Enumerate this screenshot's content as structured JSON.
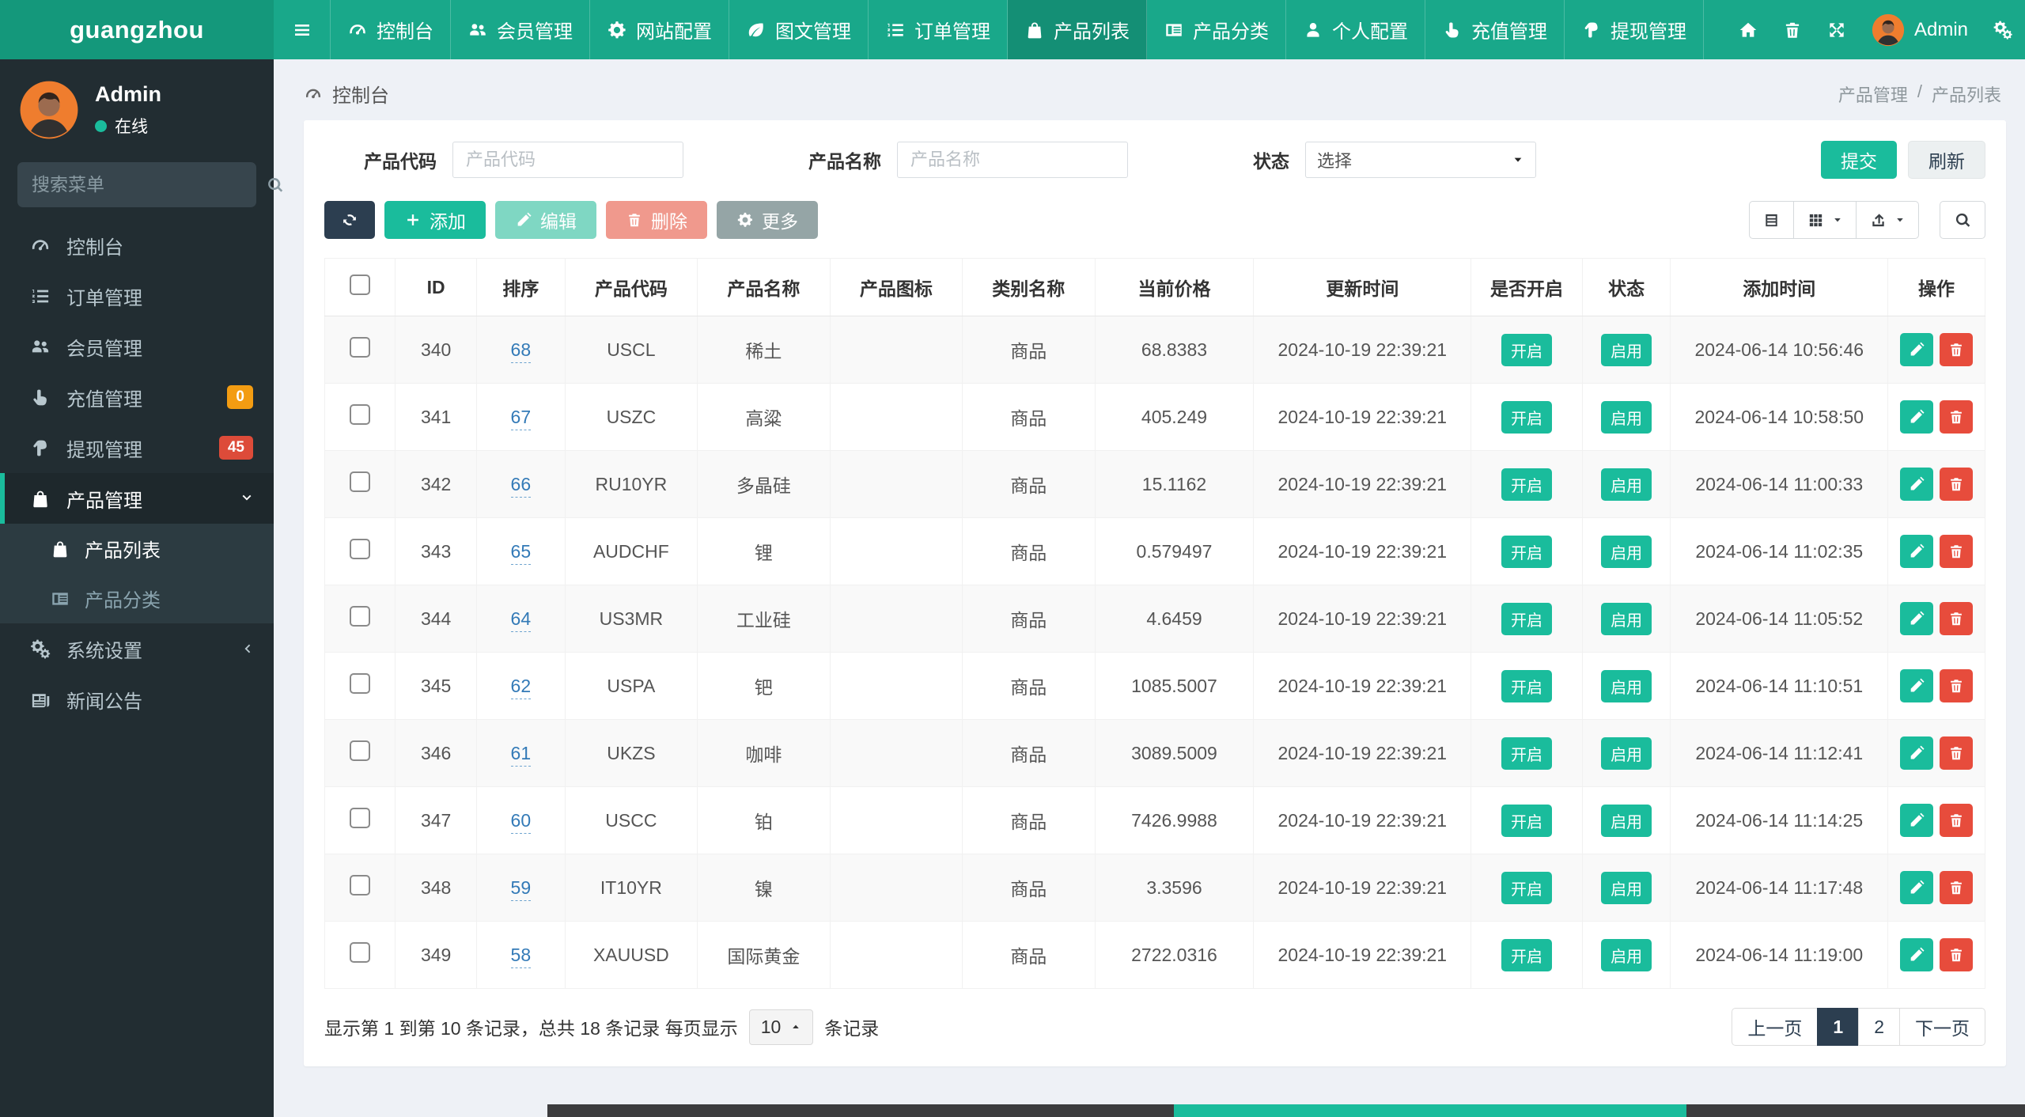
{
  "brand": "guangzhou",
  "colors": {
    "accent": "#1abc9c",
    "navbar": "#19a88a",
    "navbar_active": "#148f75",
    "sidebar": "#222d32",
    "submenu": "#2c3b41",
    "navy": "#2c3e50",
    "danger": "#e74c3c",
    "warning_badge": "#f39c12",
    "danger_badge": "#dd4b39"
  },
  "topnav": {
    "toggle_icon": "hamburger-icon",
    "items": [
      {
        "label": "控制台",
        "icon": "dashboard-icon",
        "active": false
      },
      {
        "label": "会员管理",
        "icon": "users-icon",
        "active": false
      },
      {
        "label": "网站配置",
        "icon": "gear-icon",
        "active": false
      },
      {
        "label": "图文管理",
        "icon": "leaf-icon",
        "active": false
      },
      {
        "label": "订单管理",
        "icon": "list-icon",
        "active": false
      },
      {
        "label": "产品列表",
        "icon": "bag-icon",
        "active": true
      },
      {
        "label": "产品分类",
        "icon": "category-icon",
        "active": false
      },
      {
        "label": "个人配置",
        "icon": "user-icon",
        "active": false
      },
      {
        "label": "充值管理",
        "icon": "hand-up-icon",
        "active": false
      },
      {
        "label": "提现管理",
        "icon": "hand-down-icon",
        "active": false
      }
    ],
    "right_icons": [
      "home-icon",
      "trash-icon",
      "expand-icon"
    ],
    "user": "Admin",
    "user_avatar_icon": "avatar-icon",
    "settings_icon": "gears-icon"
  },
  "sidebar": {
    "user": {
      "name": "Admin",
      "status": "在线"
    },
    "search_placeholder": "搜索菜单",
    "search_icon": "search-icon",
    "items": [
      {
        "label": "控制台",
        "icon": "dashboard-icon"
      },
      {
        "label": "订单管理",
        "icon": "list-icon"
      },
      {
        "label": "会员管理",
        "icon": "users-icon"
      },
      {
        "label": "充值管理",
        "icon": "hand-up-icon",
        "badge": "0",
        "badge_color": "#f39c12"
      },
      {
        "label": "提现管理",
        "icon": "hand-down-icon",
        "badge": "45",
        "badge_color": "#dd4b39"
      },
      {
        "label": "产品管理",
        "icon": "bag-icon",
        "active": true,
        "expanded": true,
        "children": [
          {
            "label": "产品列表",
            "icon": "bag-icon",
            "active": true
          },
          {
            "label": "产品分类",
            "icon": "category-icon",
            "active": false
          }
        ]
      },
      {
        "label": "系统设置",
        "icon": "gears-icon",
        "collapsed": true
      },
      {
        "label": "新闻公告",
        "icon": "news-icon"
      }
    ]
  },
  "header": {
    "breadcrumb_icon": "dashboard-icon",
    "breadcrumb": "控制台",
    "path": [
      "产品管理",
      "产品列表"
    ],
    "path_separator": "/"
  },
  "filters": {
    "fields": [
      {
        "label": "产品代码",
        "placeholder": "产品代码",
        "type": "input"
      },
      {
        "label": "产品名称",
        "placeholder": "产品名称",
        "type": "input"
      },
      {
        "label": "状态",
        "value": "选择",
        "type": "select"
      }
    ],
    "submit": "提交",
    "refresh": "刷新"
  },
  "toolbar": {
    "refresh_icon": "refresh-icon",
    "add": {
      "label": "添加",
      "icon": "plus-icon"
    },
    "edit": {
      "label": "编辑",
      "icon": "pencil-icon"
    },
    "delete": {
      "label": "删除",
      "icon": "trash-icon"
    },
    "more": {
      "label": "更多",
      "icon": "gear-icon"
    },
    "view_icons": [
      "table-icon",
      "grid-icon",
      "export-icon"
    ],
    "search_icon": "search-icon"
  },
  "table": {
    "columns": [
      {
        "key": "check",
        "label": ""
      },
      {
        "key": "id",
        "label": "ID"
      },
      {
        "key": "sort",
        "label": "排序"
      },
      {
        "key": "code",
        "label": "产品代码"
      },
      {
        "key": "name",
        "label": "产品名称"
      },
      {
        "key": "icon",
        "label": "产品图标"
      },
      {
        "key": "category",
        "label": "类别名称"
      },
      {
        "key": "price",
        "label": "当前价格"
      },
      {
        "key": "updated",
        "label": "更新时间"
      },
      {
        "key": "open",
        "label": "是否开启"
      },
      {
        "key": "status",
        "label": "状态"
      },
      {
        "key": "added",
        "label": "添加时间"
      },
      {
        "key": "ops",
        "label": "操作"
      }
    ],
    "rows": [
      {
        "id": "340",
        "sort": "68",
        "code": "USCL",
        "name": "稀土",
        "category": "商品",
        "price": "68.8383",
        "updated": "2024-10-19 22:39:21",
        "open": "开启",
        "status": "启用",
        "added": "2024-06-14 10:56:46"
      },
      {
        "id": "341",
        "sort": "67",
        "code": "USZC",
        "name": "高粱",
        "category": "商品",
        "price": "405.249",
        "updated": "2024-10-19 22:39:21",
        "open": "开启",
        "status": "启用",
        "added": "2024-06-14 10:58:50"
      },
      {
        "id": "342",
        "sort": "66",
        "code": "RU10YR",
        "name": "多晶硅",
        "category": "商品",
        "price": "15.1162",
        "updated": "2024-10-19 22:39:21",
        "open": "开启",
        "status": "启用",
        "added": "2024-06-14 11:00:33"
      },
      {
        "id": "343",
        "sort": "65",
        "code": "AUDCHF",
        "name": "锂",
        "category": "商品",
        "price": "0.579497",
        "updated": "2024-10-19 22:39:21",
        "open": "开启",
        "status": "启用",
        "added": "2024-06-14 11:02:35"
      },
      {
        "id": "344",
        "sort": "64",
        "code": "US3MR",
        "name": "工业硅",
        "category": "商品",
        "price": "4.6459",
        "updated": "2024-10-19 22:39:21",
        "open": "开启",
        "status": "启用",
        "added": "2024-06-14 11:05:52"
      },
      {
        "id": "345",
        "sort": "62",
        "code": "USPA",
        "name": "钯",
        "category": "商品",
        "price": "1085.5007",
        "updated": "2024-10-19 22:39:21",
        "open": "开启",
        "status": "启用",
        "added": "2024-06-14 11:10:51"
      },
      {
        "id": "346",
        "sort": "61",
        "code": "UKZS",
        "name": "咖啡",
        "category": "商品",
        "price": "3089.5009",
        "updated": "2024-10-19 22:39:21",
        "open": "开启",
        "status": "启用",
        "added": "2024-06-14 11:12:41"
      },
      {
        "id": "347",
        "sort": "60",
        "code": "USCC",
        "name": "铂",
        "category": "商品",
        "price": "7426.9988",
        "updated": "2024-10-19 22:39:21",
        "open": "开启",
        "status": "启用",
        "added": "2024-06-14 11:14:25"
      },
      {
        "id": "348",
        "sort": "59",
        "code": "IT10YR",
        "name": "镍",
        "category": "商品",
        "price": "3.3596",
        "updated": "2024-10-19 22:39:21",
        "open": "开启",
        "status": "启用",
        "added": "2024-06-14 11:17:48"
      },
      {
        "id": "349",
        "sort": "58",
        "code": "XAUUSD",
        "name": "国际黄金",
        "category": "商品",
        "price": "2722.0316",
        "updated": "2024-10-19 22:39:21",
        "open": "开启",
        "status": "启用",
        "added": "2024-06-14 11:19:00"
      }
    ]
  },
  "grid_footer": {
    "summary_before": "显示第 1 到第 10 条记录，总共 18 条记录 每页显示",
    "page_size": "10",
    "page_size_caret": "caret-up-icon",
    "summary_after": "条记录",
    "pagination": {
      "prev": "上一页",
      "pages": [
        "1",
        "2"
      ],
      "active": "1",
      "next": "下一页"
    }
  }
}
